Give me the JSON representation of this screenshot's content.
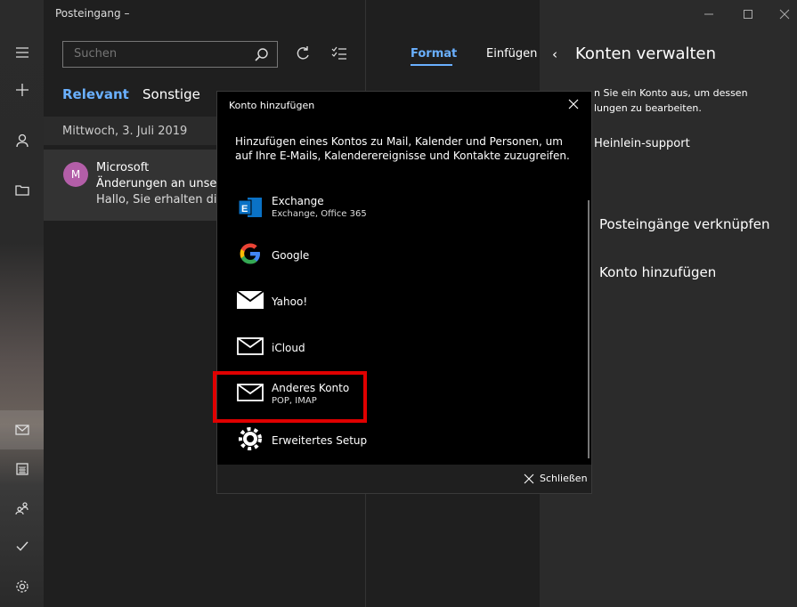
{
  "inbox": {
    "title": "Posteingang –",
    "search_placeholder": "Suchen",
    "tabs": [
      "Relevant",
      "Sonstige"
    ],
    "date_header": "Mittwoch, 3. Juli 2019",
    "message": {
      "avatar": "M",
      "sender": "Microsoft",
      "subject": "Änderungen an unsere",
      "preview": "Hallo, Sie erhalten die"
    }
  },
  "compose": {
    "tabs": [
      "Format",
      "Einfügen"
    ],
    "accent": "#6ab0ff"
  },
  "right_panel": {
    "title": "Konten verwalten",
    "desc_line1": "n Sie ein Konto aus, um dessen",
    "desc_line2": "lungen zu bearbeiten.",
    "account": "Heinlein-support",
    "link_inbox": "Posteingänge verknüpfen",
    "link_add": "Konto hinzufügen"
  },
  "dialog": {
    "title": "Konto hinzufügen",
    "description": "Hinzufügen eines Kontos zu Mail, Kalender und Personen, um auf Ihre E-Mails, Kalenderereignisse und Kontakte zuzugreifen.",
    "accounts": [
      {
        "name": "Exchange",
        "sub": "Exchange, Office 365",
        "icon": "exchange-icon"
      },
      {
        "name": "Google",
        "sub": "",
        "icon": "google-icon"
      },
      {
        "name": "Yahoo!",
        "sub": "",
        "icon": "yahoo-mail-icon"
      },
      {
        "name": "iCloud",
        "sub": "",
        "icon": "icloud-mail-icon"
      },
      {
        "name": "Anderes Konto",
        "sub": "POP, IMAP",
        "icon": "envelope-icon"
      },
      {
        "name": "Erweitertes Setup",
        "sub": "",
        "icon": "gear-icon"
      }
    ],
    "close_label": "Schließen",
    "highlight_color": "#e00000"
  }
}
